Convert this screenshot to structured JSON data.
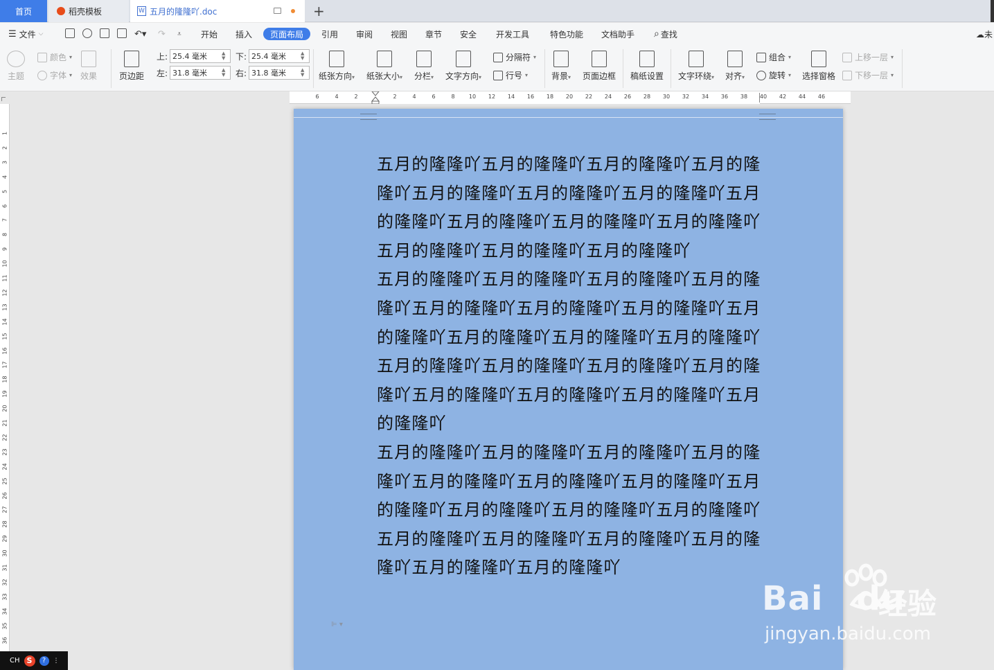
{
  "tabs": {
    "home": "首页",
    "template": "稻壳模板",
    "document": "五月的隆隆吖.doc",
    "add": "+"
  },
  "menu": {
    "file": "文件",
    "items": [
      "开始",
      "插入",
      "页面布局",
      "引用",
      "审阅",
      "视图",
      "章节",
      "安全",
      "开发工具",
      "特色功能",
      "文档助手"
    ],
    "active": "页面布局",
    "search": "查找",
    "cloud": "未"
  },
  "ribbon": {
    "theme": "主题",
    "color": "颜色",
    "font": "字体",
    "effect": "效果",
    "margins": "页边距",
    "top_label": "上:",
    "top_value": "25.4 毫米",
    "bottom_label": "下:",
    "bottom_value": "25.4 毫米",
    "left_label": "左:",
    "left_value": "31.8 毫米",
    "right_label": "右:",
    "right_value": "31.8 毫米",
    "orientation": "纸张方向",
    "size": "纸张大小",
    "columns": "分栏",
    "text_direction": "文字方向",
    "breaks": "分隔符",
    "line_numbers": "行号",
    "background": "背景",
    "page_border": "页面边框",
    "manuscript": "稿纸设置",
    "text_wrap": "文字环绕",
    "align": "对齐",
    "group": "组合",
    "rotate": "旋转",
    "selection_pane": "选择窗格",
    "bring_forward": "上移一层",
    "send_backward": "下移一层"
  },
  "ruler": {
    "h_left": [
      "6",
      "4",
      "2"
    ],
    "h_right": [
      "2",
      "4",
      "6",
      "8",
      "10",
      "12",
      "14",
      "16",
      "18",
      "20",
      "22",
      "24",
      "26",
      "28",
      "30",
      "32",
      "34",
      "36",
      "38",
      "40",
      "42",
      "44",
      "46"
    ],
    "v": [
      "1",
      "2",
      "3",
      "4",
      "5",
      "6",
      "7",
      "8",
      "9",
      "10",
      "11",
      "12",
      "13",
      "14",
      "15",
      "16",
      "17",
      "18",
      "19",
      "20",
      "21",
      "22",
      "23",
      "24",
      "25",
      "26",
      "27",
      "28",
      "29",
      "30",
      "31",
      "32",
      "33",
      "34",
      "35",
      "36"
    ]
  },
  "document": {
    "paragraphs": [
      "五月的隆隆吖五月的隆隆吖五月的隆隆吖五月的隆隆吖五月的隆隆吖五月的隆隆吖五月的隆隆吖五月的隆隆吖五月的隆隆吖五月的隆隆吖五月的隆隆吖五月的隆隆吖五月的隆隆吖五月的隆隆吖",
      "五月的隆隆吖五月的隆隆吖五月的隆隆吖五月的隆隆吖五月的隆隆吖五月的隆隆吖五月的隆隆吖五月的隆隆吖五月的隆隆吖五月的隆隆吖五月的隆隆吖",
      "五月的隆隆吖五月的隆隆吖五月的隆隆吖五月的隆隆吖五月的隆隆吖五月的隆隆吖五月的隆隆吖五月的隆隆吖",
      "五月的隆隆吖五月的隆隆吖五月的隆隆吖五月的隆隆吖五月的隆隆吖五月的隆隆吖五月的隆隆吖五月的隆隆吖五月的隆隆吖五月的隆隆吖五月的隆隆吖",
      "五月的隆隆吖五月的隆隆吖五月的隆隆吖五月的隆隆吖五月的隆隆吖五月的隆隆吖"
    ]
  },
  "watermark": {
    "logo": "Bai",
    "logo2": "du",
    "cn": "经验",
    "url": "jingyan.baidu.com"
  },
  "ime": {
    "lang": "CH",
    "s": "S",
    "help": "?"
  },
  "colors": {
    "accent": "#3f7de8",
    "page_background": "#8eb3e3"
  }
}
